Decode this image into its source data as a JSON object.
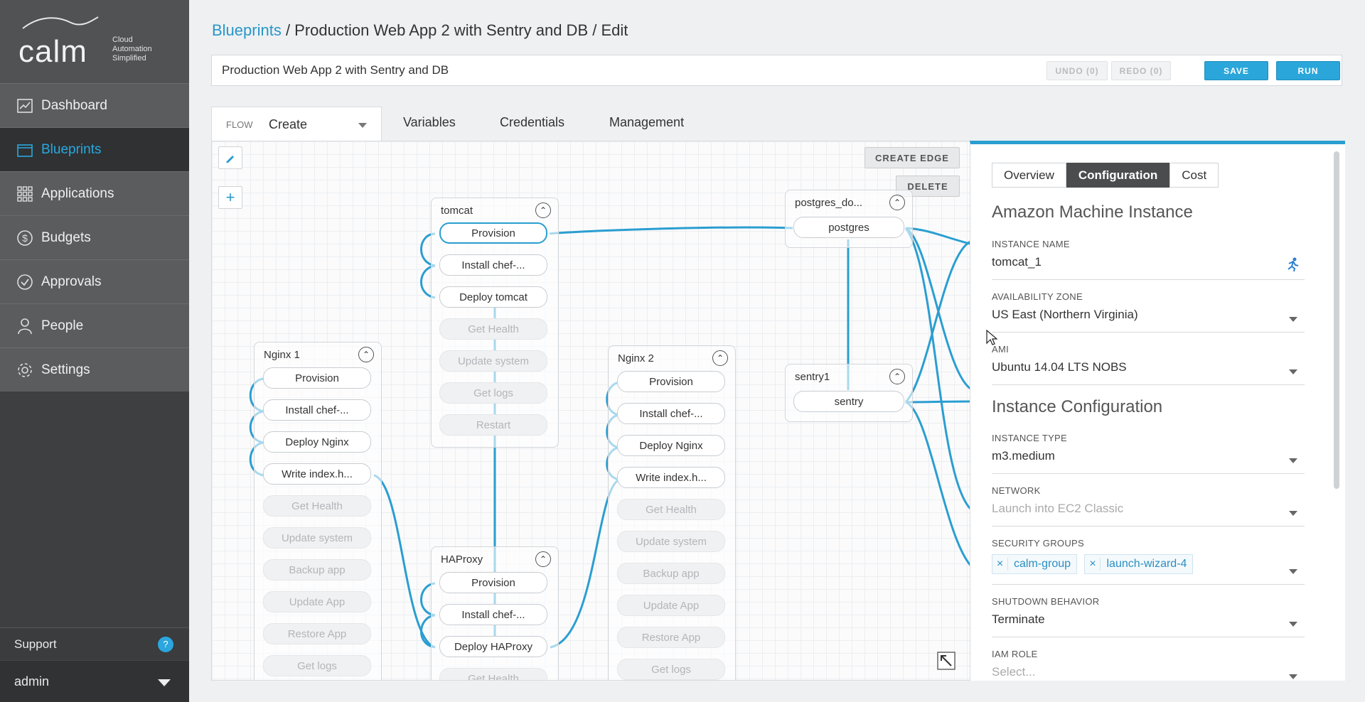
{
  "app": {
    "brand": "calm",
    "tagline_1": "Cloud",
    "tagline_2": "Automation",
    "tagline_3": "Simplified"
  },
  "sidebar": {
    "items": [
      {
        "label": "Dashboard",
        "icon": "chart-icon"
      },
      {
        "label": "Blueprints",
        "icon": "blueprint-icon",
        "active": true
      },
      {
        "label": "Applications",
        "icon": "grid-icon"
      },
      {
        "label": "Budgets",
        "icon": "dollar-icon"
      },
      {
        "label": "Approvals",
        "icon": "check-circle-icon"
      },
      {
        "label": "People",
        "icon": "person-icon"
      },
      {
        "label": "Settings",
        "icon": "gear-icon"
      }
    ],
    "support": "Support",
    "support_badge": "?",
    "user": "admin"
  },
  "header": {
    "breadcrumb_link": "Blueprints",
    "breadcrumb_rest": " / Production Web App 2 with Sentry and DB / Edit",
    "blueprint_name": "Production Web App 2 with Sentry and DB",
    "undo": "UNDO (0)",
    "redo": "REDO (0)",
    "save": "SAVE",
    "run": "RUN"
  },
  "tabs": {
    "flow_label": "FLOW",
    "flow_value": "Create",
    "variables": "Variables",
    "credentials": "Credentials",
    "management": "Management"
  },
  "canvas": {
    "create_edge": "CREATE EDGE",
    "delete": "DELETE",
    "services": {
      "tomcat": {
        "name": "tomcat",
        "actions": [
          "Provision",
          "Install chef-...",
          "Deploy tomcat",
          "Get Health",
          "Update system",
          "Get logs",
          "Restart"
        ]
      },
      "nginx1": {
        "name": "Nginx 1",
        "actions": [
          "Provision",
          "Install chef-...",
          "Deploy Nginx",
          "Write index.h...",
          "Get Health",
          "Update system",
          "Backup app",
          "Update App",
          "Restore App",
          "Get logs"
        ]
      },
      "nginx2": {
        "name": "Nginx 2",
        "actions": [
          "Provision",
          "Install chef-...",
          "Deploy Nginx",
          "Write index.h...",
          "Get Health",
          "Update system",
          "Backup app",
          "Update App",
          "Restore App",
          "Get logs"
        ]
      },
      "haproxy": {
        "name": "HAProxy",
        "actions": [
          "Provision",
          "Install chef-...",
          "Deploy HAProxy",
          "Get Health"
        ]
      },
      "postgres": {
        "name": "postgres_do...",
        "actions": [
          "postgres"
        ]
      },
      "sentry": {
        "name": "sentry1",
        "actions": [
          "sentry"
        ]
      }
    },
    "edge_color": "#2a9ed1"
  },
  "panel": {
    "tabs": [
      "Overview",
      "Configuration",
      "Cost"
    ],
    "active_tab": "Configuration",
    "section1": "Amazon Machine Instance",
    "instance_name_label": "INSTANCE NAME",
    "instance_name": "tomcat_1",
    "az_label": "AVAILABILITY ZONE",
    "az": "US East (Northern Virginia)",
    "ami_label": "AMI",
    "ami": "Ubuntu 14.04 LTS NOBS",
    "section2": "Instance Configuration",
    "type_label": "INSTANCE TYPE",
    "type": "m3.medium",
    "network_label": "NETWORK",
    "network": "Launch into EC2 Classic",
    "sg_label": "SECURITY GROUPS",
    "sg": [
      "calm-group",
      "launch-wizard-4"
    ],
    "sg_remove": "×",
    "shutdown_label": "SHUTDOWN BEHAVIOR",
    "shutdown": "Terminate",
    "iam_label": "IAM ROLE",
    "iam": "Select..."
  }
}
